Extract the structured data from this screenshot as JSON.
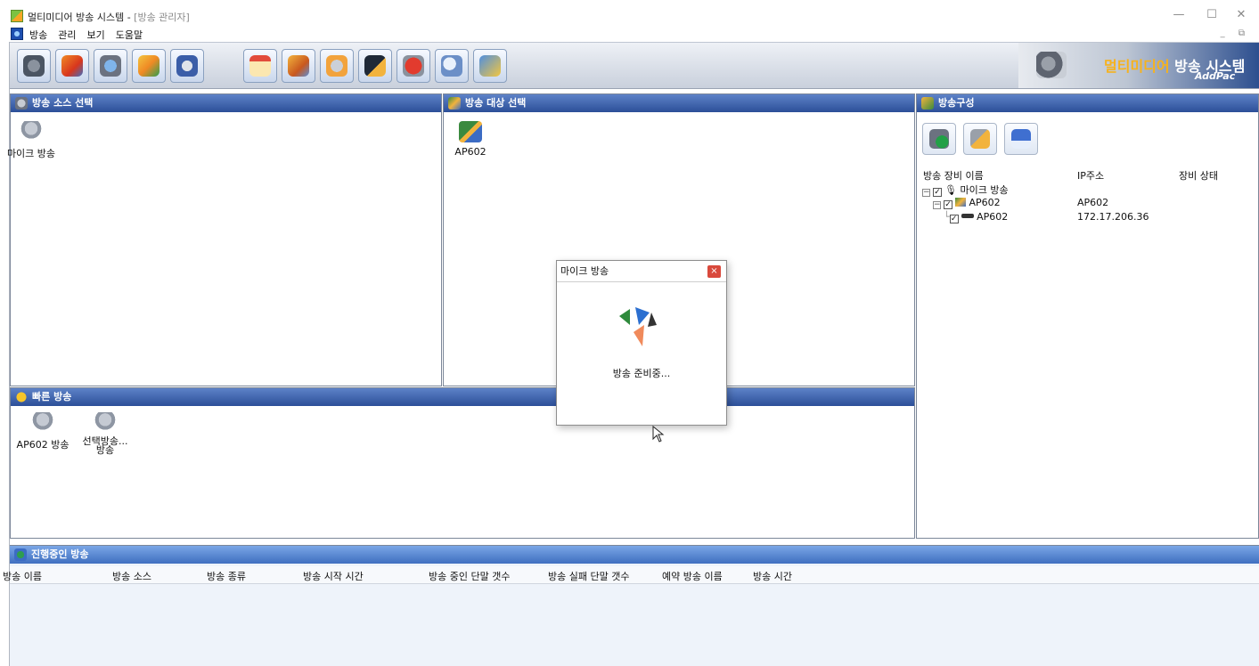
{
  "window": {
    "title": "멀티미디어 방송 시스템 - ",
    "doc_title": "[방송 관리자]",
    "minimize": "—",
    "maximize": "☐",
    "close": "✕"
  },
  "menu": {
    "items": [
      "방송",
      "관리",
      "보기",
      "도움말"
    ],
    "mdi_controls": "_ ⧉"
  },
  "toolbar": {
    "icons": [
      "camera-mic-icon",
      "fire-alarm-icon",
      "network-settings-icon",
      "bell-icon",
      "clock-icon",
      "calendar-icon",
      "users-icon",
      "gear-users-icon",
      "terminal-icon",
      "stop-icon",
      "search-icon",
      "refresh-icon"
    ],
    "brand_text_highlight": "멀티미디어",
    "brand_text_rest": " 방송 시스템",
    "brand_sub": "AddPac"
  },
  "source_panel": {
    "title": "방송 소스 선택",
    "items": [
      {
        "label": "마이크 방송",
        "icon": "microphone-icon"
      }
    ]
  },
  "target_panel": {
    "title": "방송 대상 선택",
    "items": [
      {
        "label": "AP602",
        "icon": "group-icon"
      }
    ]
  },
  "config_panel": {
    "title": "방송구성",
    "buttons": [
      "play-broadcast-icon",
      "mic-star-icon",
      "save-icon"
    ],
    "columns": [
      "방송 장비 이름",
      "IP주소",
      "장비 상태"
    ],
    "tree": [
      {
        "label": "마이크 방송",
        "ip": "",
        "level": 0
      },
      {
        "label": "AP602",
        "ip": "AP602",
        "level": 1
      },
      {
        "label": "AP602",
        "ip": "172.17.206.36",
        "level": 2
      }
    ]
  },
  "quick_panel": {
    "title": "빠른 방송",
    "items": [
      {
        "label": "AP602 방송",
        "label2": "",
        "icon": "microphone-icon"
      },
      {
        "label": "선택방송...",
        "label2": "방송",
        "icon": "microphone-icon"
      }
    ]
  },
  "running_panel": {
    "title": "진행중인 방송",
    "columns": [
      "방송 이름",
      "방송 소스",
      "방송 종류",
      "방송 시작 시간",
      "방송 중인 단말 갯수",
      "방송 실패 단말 갯수",
      "예약 방송 이름",
      "방송 시간"
    ]
  },
  "modal": {
    "title": "마이크 방송",
    "close": "×",
    "message": "방송 준비중..."
  }
}
